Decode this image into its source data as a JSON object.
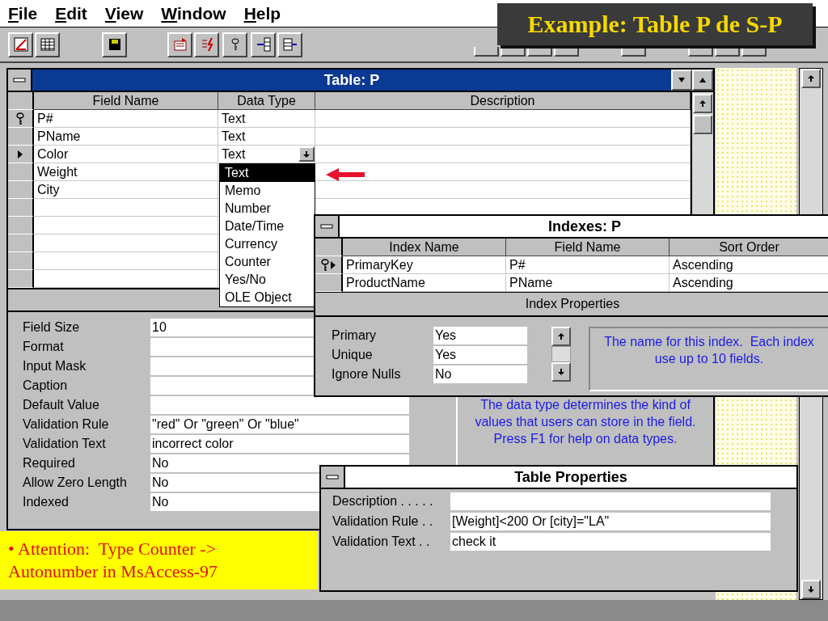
{
  "menu": [
    {
      "label": "File"
    },
    {
      "label": "Edit"
    },
    {
      "label": "View"
    },
    {
      "label": "Window"
    },
    {
      "label": "Help"
    }
  ],
  "banner": {
    "title": "Example: Table P de S-P"
  },
  "table_window": {
    "title": "Table: P",
    "columns": [
      "Field Name",
      "Data Type",
      "Description"
    ],
    "fields": [
      {
        "name": "P#",
        "data_type": "Text",
        "primary_key": true,
        "current": false
      },
      {
        "name": "PName",
        "data_type": "Text",
        "primary_key": false,
        "current": false
      },
      {
        "name": "Color",
        "data_type": "Text",
        "primary_key": false,
        "current": true
      },
      {
        "name": "Weight",
        "primary_key": false,
        "current": false
      },
      {
        "name": "City",
        "primary_key": false,
        "current": false
      }
    ],
    "data_type_dropdown": {
      "options": [
        {
          "label": "Text",
          "selected": true
        },
        {
          "label": "Memo",
          "selected": false
        },
        {
          "label": "Number",
          "selected": false
        },
        {
          "label": "Date/Time",
          "selected": false
        },
        {
          "label": "Currency",
          "selected": false
        },
        {
          "label": "Counter",
          "selected": false
        },
        {
          "label": "Yes/No",
          "selected": false
        },
        {
          "label": "OLE Object",
          "selected": false
        }
      ]
    },
    "field_properties": [
      {
        "label": "Field Size",
        "value": "10"
      },
      {
        "label": "Format"
      },
      {
        "label": "Input Mask"
      },
      {
        "label": "Caption"
      },
      {
        "label": "Default Value"
      },
      {
        "label": "Validation Rule",
        "value": "\"red\" Or \"green\" Or \"blue\""
      },
      {
        "label": "Validation Text",
        "value": "incorrect color"
      },
      {
        "label": "Required",
        "value": "No"
      },
      {
        "label": "Allow Zero Length",
        "value": "No"
      },
      {
        "label": "Indexed",
        "value": "No"
      }
    ],
    "help_text": "The data type determines the kind of\nvalues that users can store in the field.\nPress F1 for help on data types."
  },
  "indexes_window": {
    "title": "Indexes: P",
    "columns": [
      "Index Name",
      "Field Name",
      "Sort Order"
    ],
    "rows": [
      {
        "index_name": "PrimaryKey",
        "field_name": "P#",
        "sort_order": "Ascending",
        "primary_key": true,
        "current": true
      },
      {
        "index_name": "ProductName",
        "field_name": "PName",
        "sort_order": "Ascending",
        "primary_key": false,
        "current": false
      }
    ],
    "properties_heading": "Index Properties",
    "properties": [
      {
        "label": "Primary",
        "value": "Yes"
      },
      {
        "label": "Unique",
        "value": "Yes"
      },
      {
        "label": "Ignore Nulls",
        "value": "No"
      }
    ],
    "help_text": "The name for this index.  Each index\nuse up to 10 fields."
  },
  "table_properties_window": {
    "title": "Table Properties",
    "properties": [
      {
        "label": "Description . . . . ."
      },
      {
        "label": "Validation Rule . .",
        "value": "[Weight]<200 Or [city]=\"LA\""
      },
      {
        "label": "Validation Text . .",
        "value": "check it"
      }
    ]
  },
  "note": {
    "text": "• Attention:  Type Counter ->\nAutonumber in MsAccess-97"
  }
}
